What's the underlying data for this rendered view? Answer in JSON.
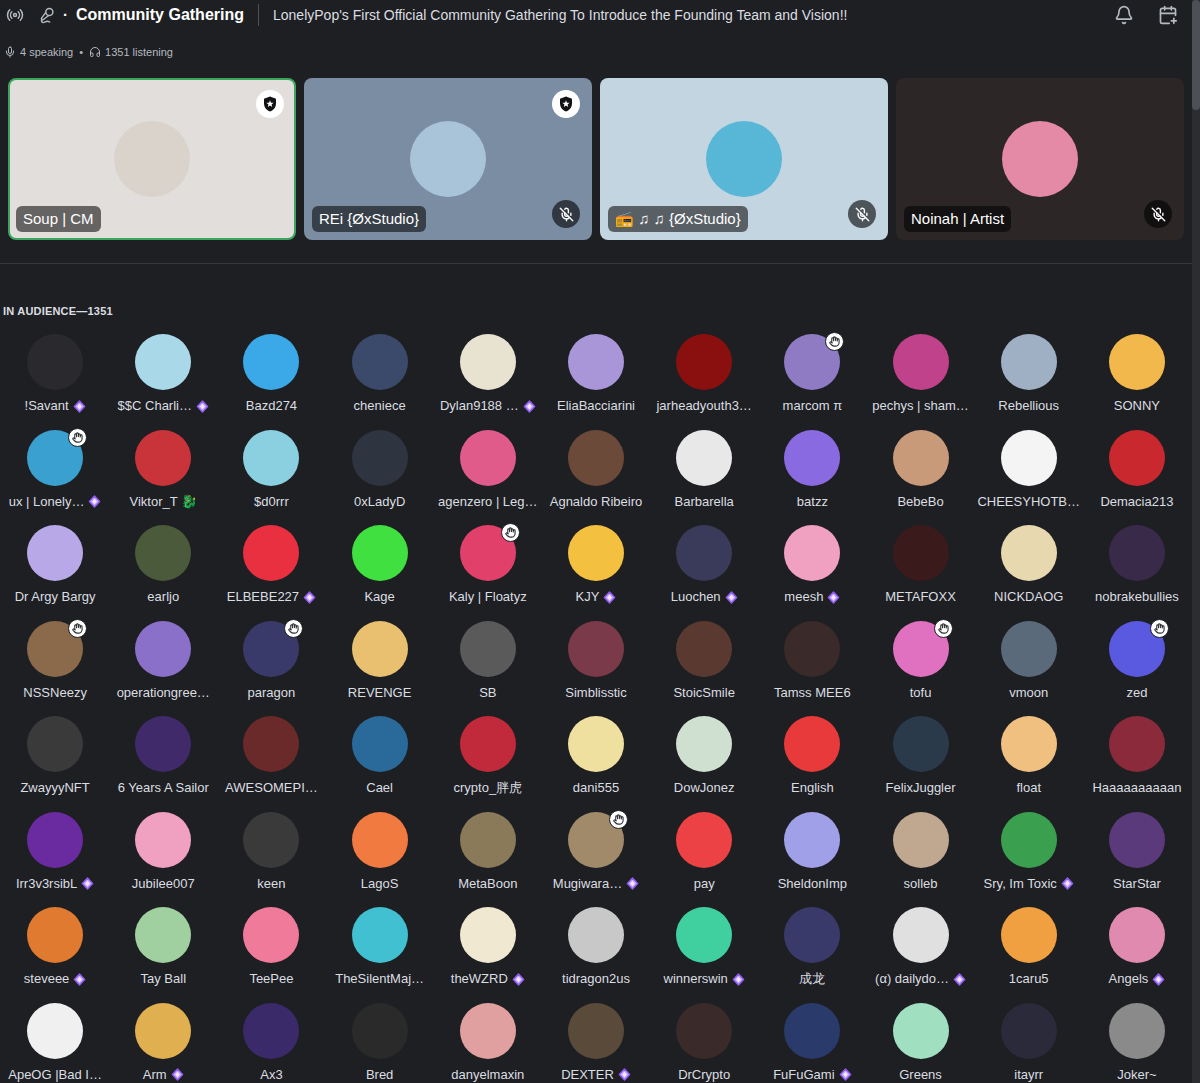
{
  "header": {
    "title_separator": "·",
    "title": "Community Gathering",
    "topic": "LonelyPop's First Official Community Gathering To Introduce the Founding Team and Vision!!"
  },
  "status": {
    "speaking": "4 speaking",
    "separator": "•",
    "listening": "1351 listening"
  },
  "speakers": [
    {
      "name": "Soup | CM",
      "color": "#e2dedb",
      "avatar_color": "#d9d3cc",
      "speaking": true,
      "moderator": true,
      "muted": false
    },
    {
      "name": "REi {ØxStudio}",
      "color": "#7a8da3",
      "avatar_color": "#a9c3d8",
      "speaking": false,
      "moderator": true,
      "muted": true
    },
    {
      "name": "📻 ♫ ♫ {ØxStudio}",
      "color": "#c3d5e1",
      "avatar_color": "#58b7d6",
      "speaking": false,
      "moderator": false,
      "muted": true
    },
    {
      "name": "Noinah | Artist",
      "color": "#2c2627",
      "avatar_color": "#e48aa6",
      "speaking": false,
      "moderator": false,
      "muted": true
    }
  ],
  "audience_label": "IN AUDIENCE—1351",
  "audience": [
    {
      "name": "!Savant",
      "avatar_color": "#2a2a2e",
      "hand_raised": false,
      "boosted": true
    },
    {
      "name": "$$C Charli…",
      "avatar_color": "#a9d8e8",
      "hand_raised": false,
      "boosted": true
    },
    {
      "name": "Bazd274",
      "avatar_color": "#3ba9e8",
      "hand_raised": false,
      "boosted": false
    },
    {
      "name": "cheniece",
      "avatar_color": "#3b4a6b",
      "hand_raised": false,
      "boosted": false
    },
    {
      "name": "Dylan9188 …",
      "avatar_color": "#e8e2d0",
      "hand_raised": false,
      "boosted": true
    },
    {
      "name": "EliaBacciarini",
      "avatar_color": "#a996d8",
      "hand_raised": false,
      "boosted": false
    },
    {
      "name": "jarheadyouth3…",
      "avatar_color": "#8a1010",
      "hand_raised": false,
      "boosted": false
    },
    {
      "name": "marcom π",
      "avatar_color": "#8e7bc4",
      "hand_raised": true,
      "boosted": false
    },
    {
      "name": "pechys | sham…",
      "avatar_color": "#c0428a",
      "hand_raised": false,
      "boosted": false
    },
    {
      "name": "Rebellious",
      "avatar_color": "#9fb0c4",
      "hand_raised": false,
      "boosted": false
    },
    {
      "name": "SONNY",
      "avatar_color": "#f2b84b",
      "hand_raised": false,
      "boosted": false
    },
    {
      "name": "ux | Lonely…",
      "avatar_color": "#3aa0d0",
      "hand_raised": true,
      "boosted": true
    },
    {
      "name": "Viktor_T 🐉",
      "avatar_color": "#c8343a",
      "hand_raised": false,
      "boosted": false
    },
    {
      "name": "$d0rrr",
      "avatar_color": "#8ad0e0",
      "hand_raised": false,
      "boosted": false
    },
    {
      "name": "0xLadyD",
      "avatar_color": "#2e3440",
      "hand_raised": false,
      "boosted": false
    },
    {
      "name": "agenzero | Leg…",
      "avatar_color": "#e05a8a",
      "hand_raised": false,
      "boosted": false
    },
    {
      "name": "Agnaldo Ribeiro",
      "avatar_color": "#6b4a3a",
      "hand_raised": false,
      "boosted": false
    },
    {
      "name": "Barbarella",
      "avatar_color": "#e8e8e8",
      "hand_raised": false,
      "boosted": false
    },
    {
      "name": "batzz",
      "avatar_color": "#8a6ae0",
      "hand_raised": false,
      "boosted": false
    },
    {
      "name": "BebeBo",
      "avatar_color": "#c89a7a",
      "hand_raised": false,
      "boosted": false
    },
    {
      "name": "CHEESYHOTB…",
      "avatar_color": "#f4f4f4",
      "hand_raised": false,
      "boosted": false
    },
    {
      "name": "Demacia213",
      "avatar_color": "#c8282e",
      "hand_raised": false,
      "boosted": false
    },
    {
      "name": "Dr Argy Bargy",
      "avatar_color": "#b8a8e8",
      "hand_raised": false,
      "boosted": false
    },
    {
      "name": "earljo",
      "avatar_color": "#4a5a3a",
      "hand_raised": false,
      "boosted": false
    },
    {
      "name": "ELBEBE227",
      "avatar_color": "#e83040",
      "hand_raised": false,
      "boosted": true
    },
    {
      "name": "Kage",
      "avatar_color": "#40e040",
      "hand_raised": false,
      "boosted": false
    },
    {
      "name": "Kaly | Floatyz",
      "avatar_color": "#e0406a",
      "hand_raised": true,
      "boosted": false
    },
    {
      "name": "KJY",
      "avatar_color": "#f4c040",
      "hand_raised": false,
      "boosted": true
    },
    {
      "name": "Luochen",
      "avatar_color": "#3a3a5a",
      "hand_raised": false,
      "boosted": true
    },
    {
      "name": "meesh",
      "avatar_color": "#f0a0c0",
      "hand_raised": false,
      "boosted": true
    },
    {
      "name": "METAFOXX",
      "avatar_color": "#3a1a1a",
      "hand_raised": false,
      "boosted": false
    },
    {
      "name": "NICKDAOG",
      "avatar_color": "#e8d8b0",
      "hand_raised": false,
      "boosted": false
    },
    {
      "name": "nobrakebullies",
      "avatar_color": "#3a2a4a",
      "hand_raised": false,
      "boosted": false
    },
    {
      "name": "NSSNeezy",
      "avatar_color": "#8a6a4a",
      "hand_raised": true,
      "boosted": false
    },
    {
      "name": "operationgree…",
      "avatar_color": "#8a70c8",
      "hand_raised": false,
      "boosted": false
    },
    {
      "name": "paragon",
      "avatar_color": "#3a3a6a",
      "hand_raised": true,
      "boosted": false
    },
    {
      "name": "REVENGE",
      "avatar_color": "#e8c070",
      "hand_raised": false,
      "boosted": false
    },
    {
      "name": "SB",
      "avatar_color": "#5a5a5a",
      "hand_raised": false,
      "boosted": false
    },
    {
      "name": "Simblisstic",
      "avatar_color": "#7a3a4a",
      "hand_raised": false,
      "boosted": false
    },
    {
      "name": "StoicSmile",
      "avatar_color": "#5a3a30",
      "hand_raised": false,
      "boosted": false
    },
    {
      "name": "Tamss MEE6",
      "avatar_color": "#3a2a2a",
      "hand_raised": false,
      "boosted": false
    },
    {
      "name": "tofu",
      "avatar_color": "#e070c0",
      "hand_raised": true,
      "boosted": false
    },
    {
      "name": "vmoon",
      "avatar_color": "#5a6a7a",
      "hand_raised": false,
      "boosted": false
    },
    {
      "name": "zed",
      "avatar_color": "#5a5ae0",
      "hand_raised": true,
      "boosted": false
    },
    {
      "name": "ZwayyyNFT",
      "avatar_color": "#3a3a3a",
      "hand_raised": false,
      "boosted": false
    },
    {
      "name": "6 Years A Sailor",
      "avatar_color": "#402a6a",
      "hand_raised": false,
      "boosted": false
    },
    {
      "name": "AWESOMEPI…",
      "avatar_color": "#6a2a2a",
      "hand_raised": false,
      "boosted": false
    },
    {
      "name": "Cael",
      "avatar_color": "#2a6a9a",
      "hand_raised": false,
      "boosted": false
    },
    {
      "name": "crypto_胖虎",
      "avatar_color": "#c02a3a",
      "hand_raised": false,
      "boosted": false
    },
    {
      "name": "dani555",
      "avatar_color": "#f0e0a0",
      "hand_raised": false,
      "boosted": false
    },
    {
      "name": "DowJonez",
      "avatar_color": "#d0e0d0",
      "hand_raised": false,
      "boosted": false
    },
    {
      "name": "English",
      "avatar_color": "#e83a3a",
      "hand_raised": false,
      "boosted": false
    },
    {
      "name": "FelixJuggler",
      "avatar_color": "#2a3a4a",
      "hand_raised": false,
      "boosted": false
    },
    {
      "name": "float",
      "avatar_color": "#f0c080",
      "hand_raised": false,
      "boosted": false
    },
    {
      "name": "Haaaaaaaaaan",
      "avatar_color": "#8a2a3a",
      "hand_raised": false,
      "boosted": false
    },
    {
      "name": "Irr3v3rsibL",
      "avatar_color": "#6a2aa0",
      "hand_raised": false,
      "boosted": true
    },
    {
      "name": "Jubilee007",
      "avatar_color": "#f0a0c0",
      "hand_raised": false,
      "boosted": false
    },
    {
      "name": "keen",
      "avatar_color": "#3a3a3a",
      "hand_raised": false,
      "boosted": false
    },
    {
      "name": "LagoS",
      "avatar_color": "#f07a40",
      "hand_raised": false,
      "boosted": false
    },
    {
      "name": "MetaBoon",
      "avatar_color": "#8a7a5a",
      "hand_raised": false,
      "boosted": false
    },
    {
      "name": "Mugiwara…",
      "avatar_color": "#a08a6a",
      "hand_raised": true,
      "boosted": true
    },
    {
      "name": "pay",
      "avatar_color": "#ed4245",
      "hand_raised": false,
      "boosted": false
    },
    {
      "name": "SheldonImp",
      "avatar_color": "#a0a0e8",
      "hand_raised": false,
      "boosted": false
    },
    {
      "name": "solleb",
      "avatar_color": "#c0a890",
      "hand_raised": false,
      "boosted": false
    },
    {
      "name": "Sry, Im Toxic",
      "avatar_color": "#3aa050",
      "hand_raised": false,
      "boosted": true
    },
    {
      "name": "StarStar",
      "avatar_color": "#5a3a7a",
      "hand_raised": false,
      "boosted": false
    },
    {
      "name": "steveee",
      "avatar_color": "#e07a30",
      "hand_raised": false,
      "boosted": true
    },
    {
      "name": "Tay Ball",
      "avatar_color": "#a0d0a0",
      "hand_raised": false,
      "boosted": false
    },
    {
      "name": "TeePee",
      "avatar_color": "#f07a9a",
      "hand_raised": false,
      "boosted": false
    },
    {
      "name": "TheSilentMaj…",
      "avatar_color": "#40c0d0",
      "hand_raised": false,
      "boosted": false
    },
    {
      "name": "theWZRD",
      "avatar_color": "#f0e8d0",
      "hand_raised": false,
      "boosted": true
    },
    {
      "name": "tidragon2us",
      "avatar_color": "#c8c8c8",
      "hand_raised": false,
      "boosted": false
    },
    {
      "name": "winnerswin",
      "avatar_color": "#40d0a0",
      "hand_raised": false,
      "boosted": true
    },
    {
      "name": "成龙",
      "avatar_color": "#3a3a6a",
      "hand_raised": false,
      "boosted": false
    },
    {
      "name": "(α) dailydo…",
      "avatar_color": "#e0e0e0",
      "hand_raised": false,
      "boosted": true
    },
    {
      "name": "1caru5",
      "avatar_color": "#f0a040",
      "hand_raised": false,
      "boosted": false
    },
    {
      "name": "Angels",
      "avatar_color": "#e08ab0",
      "hand_raised": false,
      "boosted": true
    },
    {
      "name": "ApeOG |Bad I…",
      "avatar_color": "#f0f0f0",
      "hand_raised": false,
      "boosted": false
    },
    {
      "name": "Arm",
      "avatar_color": "#e0b050",
      "hand_raised": false,
      "boosted": true
    },
    {
      "name": "Ax3",
      "avatar_color": "#3a2a6a",
      "hand_raised": false,
      "boosted": false
    },
    {
      "name": "Bred",
      "avatar_color": "#2a2a2a",
      "hand_raised": false,
      "boosted": false
    },
    {
      "name": "danyelmaxin",
      "avatar_color": "#e0a0a0",
      "hand_raised": false,
      "boosted": false
    },
    {
      "name": "DEXTER",
      "avatar_color": "#5a4a3a",
      "hand_raised": false,
      "boosted": true
    },
    {
      "name": "DrCrypto",
      "avatar_color": "#3a2a2a",
      "hand_raised": false,
      "boosted": false
    },
    {
      "name": "FuFuGami",
      "avatar_color": "#2a3a6a",
      "hand_raised": false,
      "boosted": true
    },
    {
      "name": "Greens",
      "avatar_color": "#a0e0c0",
      "hand_raised": false,
      "boosted": false
    },
    {
      "name": "itayrr",
      "avatar_color": "#2a2a3a",
      "hand_raised": false,
      "boosted": false
    },
    {
      "name": "Joker~",
      "avatar_color": "#8a8a8a",
      "hand_raised": false,
      "boosted": false
    }
  ]
}
